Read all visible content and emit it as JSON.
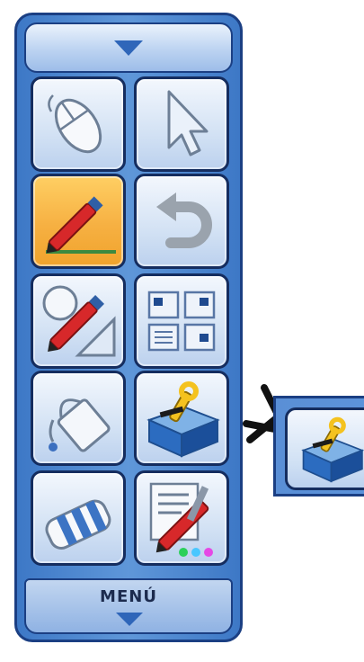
{
  "toolbar": {
    "menu_label": "MENÚ",
    "collapse_icon": "triangle-down-icon",
    "expand_icon": "triangle-down-icon",
    "buttons": [
      {
        "icon": "mouse-icon",
        "active": false
      },
      {
        "icon": "arrow-cursor-icon",
        "active": false
      },
      {
        "icon": "pen-icon",
        "active": true
      },
      {
        "icon": "undo-icon",
        "active": false
      },
      {
        "icon": "shapes-pen-icon",
        "active": false
      },
      {
        "icon": "layout-grid-icon",
        "active": false
      },
      {
        "icon": "paint-bucket-icon",
        "active": false
      },
      {
        "icon": "toolbox-icon",
        "active": false
      },
      {
        "icon": "eraser-icon",
        "active": false
      },
      {
        "icon": "pen-settings-icon",
        "active": false
      }
    ]
  },
  "callout": {
    "icon": "toolbox-icon"
  },
  "colors": {
    "toolbar_blue": "#3d78c6",
    "border_blue": "#1b3f83",
    "active_orange": "#f6b042"
  }
}
